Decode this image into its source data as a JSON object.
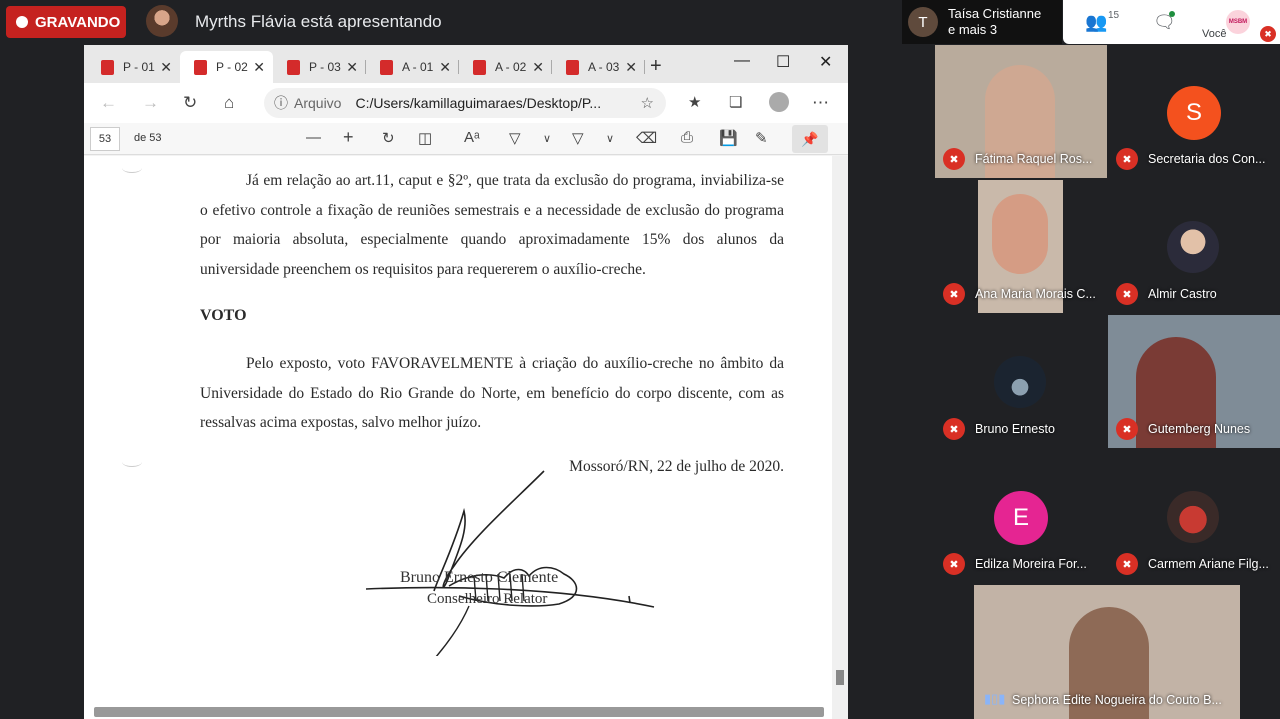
{
  "meeting": {
    "recording_label": "GRAVANDO",
    "presenter_text": "Myrths Flávia está apresentando",
    "participants_header": {
      "initial": "T",
      "line1": "Taísa Cristianne",
      "line2": "e mais 3"
    },
    "participant_count": "15",
    "self_label": "Você",
    "self_avatar_text": "MSBM"
  },
  "browser": {
    "tabs": [
      {
        "label": "P - 01"
      },
      {
        "label": "P - 02"
      },
      {
        "label": "P - 03"
      },
      {
        "label": "A - 01"
      },
      {
        "label": "A - 02"
      },
      {
        "label": "A - 03"
      }
    ],
    "address": {
      "label": "Arquivo",
      "url": "C:/Users/kamillaguimaraes/Desktop/P..."
    },
    "pdf_toolbar": {
      "page_current": "53",
      "page_total": "de 53"
    }
  },
  "document": {
    "para1": "Já em relação ao art.11, caput e §2º, que trata da exclusão do programa, inviabiliza-se o efetivo controle a fixação de reuniões semestrais e a necessidade de exclusão do programa por maioria absoluta, especialmente quando aproximadamente 15% dos alunos da universidade preenchem os requisitos para requererem o auxílio-creche.",
    "heading": "VOTO",
    "para2": "Pelo exposto, voto FAVORAVELMENTE à criação do auxílio-creche no âmbito da Universidade do Estado do Rio Grande do Norte, em benefício do corpo discente, com as ressalvas acima expostas, salvo melhor juízo.",
    "date_line": "Mossoró/RN, 22 de julho de 2020.",
    "signer_name": "Bruno Ernesto Clemente",
    "signer_role": "Conselheiro Relator"
  },
  "participants": [
    {
      "name": "Fátima Raquel Ros...",
      "muted": true
    },
    {
      "name": "Secretaria dos Con...",
      "initial": "S",
      "color": "#f4511e",
      "muted": true
    },
    {
      "name": "Ana Maria Morais C...",
      "muted": true
    },
    {
      "name": "Almir Castro",
      "muted": true
    },
    {
      "name": "Bruno Ernesto",
      "muted": true
    },
    {
      "name": "Gutemberg Nunes",
      "muted": true
    },
    {
      "name": "Edilza Moreira For...",
      "initial": "E",
      "color": "#e52592",
      "muted": true
    },
    {
      "name": "Carmem Ariane Filg...",
      "muted": true
    },
    {
      "name": "Sephora Edite Nogueira do Couto B...",
      "muted": false
    }
  ],
  "colors": {
    "record_red": "#c5221f",
    "mic_muted": "#d93025",
    "pdf_icon": "#d42b2b"
  }
}
